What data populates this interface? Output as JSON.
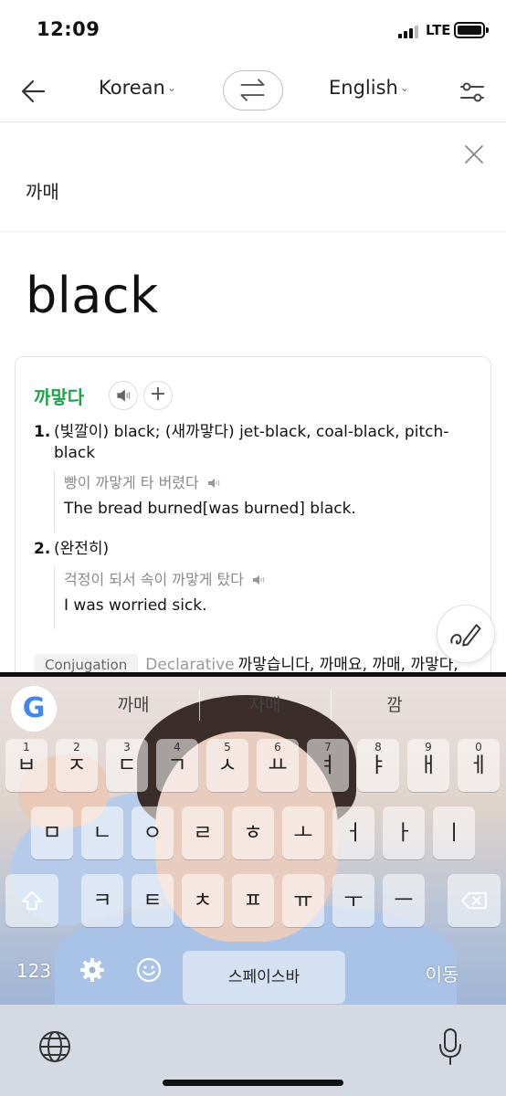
{
  "status": {
    "time": "12:09",
    "network": "LTE",
    "signal_bars": 3,
    "battery_level": 0.9
  },
  "nav": {
    "source_lang": "Korean",
    "target_lang": "English"
  },
  "input": {
    "query": "까매"
  },
  "result": {
    "translation": "black"
  },
  "dictionary": {
    "headword": "까맣다",
    "senses": [
      {
        "num": "1.",
        "text": "(빛깔이) black; (새까맣다) jet-black, coal-black, pitch-black",
        "example_ko": "빵이 까맣게 타 버렸다",
        "example_en": "The bread burned[was burned] black."
      },
      {
        "num": "2.",
        "text": "(완전히)",
        "example_ko": "걱정이 되서 속이 까맣게 탔다",
        "example_en": "I was worried sick."
      }
    ],
    "conjugation_tag": "Conjugation",
    "conjugation_label": "Declarative",
    "conjugation_forms": "까맣습니다, 까매요, 까매, 까맣다,"
  },
  "keyboard": {
    "suggestions": [
      "까매",
      "자매",
      "깜"
    ],
    "row1": [
      {
        "k": "ㅂ",
        "n": "1"
      },
      {
        "k": "ㅈ",
        "n": "2"
      },
      {
        "k": "ㄷ",
        "n": "3"
      },
      {
        "k": "ㄱ",
        "n": "4"
      },
      {
        "k": "ㅅ",
        "n": "5"
      },
      {
        "k": "ㅛ",
        "n": "6"
      },
      {
        "k": "ㅕ",
        "n": "7"
      },
      {
        "k": "ㅑ",
        "n": "8"
      },
      {
        "k": "ㅐ",
        "n": "9"
      },
      {
        "k": "ㅔ",
        "n": "0"
      }
    ],
    "row2": [
      "ㅁ",
      "ㄴ",
      "ㅇ",
      "ㄹ",
      "ㅎ",
      "ㅗ",
      "ㅓ",
      "ㅏ",
      "ㅣ"
    ],
    "row3": [
      "ㅋ",
      "ㅌ",
      "ㅊ",
      "ㅍ",
      "ㅠ",
      "ㅜ",
      "ㅡ"
    ],
    "numbers_key": "123",
    "space_label": "스페이스바",
    "action_label": "이동"
  },
  "colors": {
    "headword": "#1ea44d",
    "accent_google": "#4285f4"
  }
}
